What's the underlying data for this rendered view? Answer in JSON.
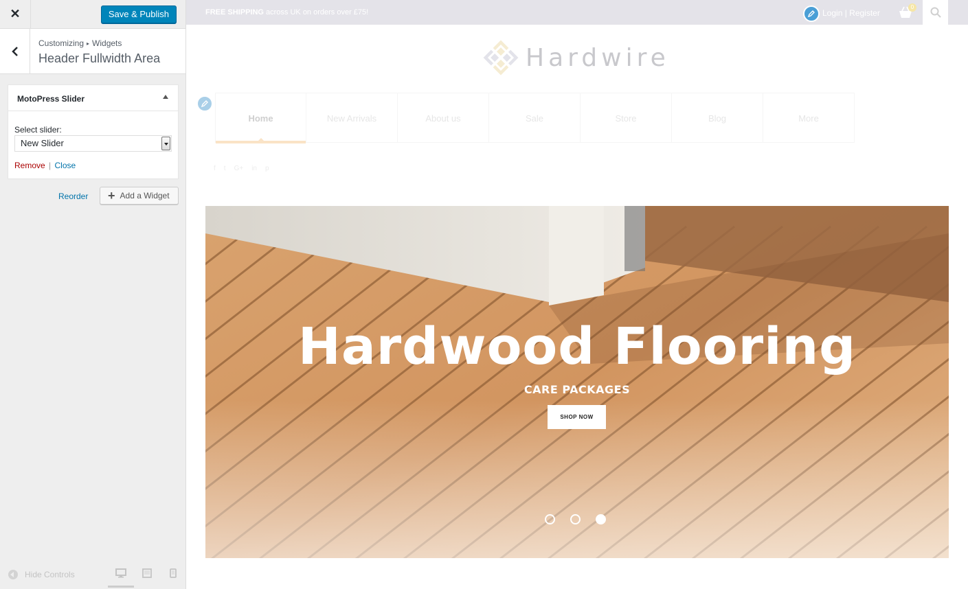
{
  "sidebar": {
    "close_label": "✕",
    "save_publish_label": "Save & Publish",
    "breadcrumb": {
      "root": "Customizing",
      "separator": "▸",
      "parent": "Widgets"
    },
    "section_title": "Header Fullwidth Area",
    "widget": {
      "title": "MotoPress Slider",
      "select_label": "Select slider:",
      "select_value": "New Slider",
      "remove_label": "Remove",
      "separator": "|",
      "close_label": "Close"
    },
    "reorder_label": "Reorder",
    "add_widget_label": "Add a Widget",
    "footer": {
      "hide_controls_label": "Hide Controls",
      "devices": [
        "desktop-icon",
        "tablet-icon",
        "mobile-icon"
      ],
      "active_device": "desktop"
    }
  },
  "preview": {
    "topbar": {
      "shipping_strong": "FREE SHIPPING",
      "shipping_rest": " across UK on orders over £75!",
      "account_label": "Login | Register",
      "cart_count": "0"
    },
    "logo_text": "Hardwire",
    "nav": [
      "Home",
      "New Arrivals",
      "About us",
      "Sale",
      "Store",
      "Blog",
      "More"
    ],
    "active_nav": "Home",
    "social_icons": [
      "f",
      "t",
      "G+",
      "in",
      "p"
    ],
    "slide": {
      "title": "Hardwood Flooring",
      "subtitle": "CARE PACKAGES",
      "button_label": "SHOP NOW",
      "dots": 3,
      "active_dot": 3
    }
  },
  "colors": {
    "primary_button": "#0085ba",
    "link": "#0073aa",
    "remove_link": "#aa0000",
    "topbar_bg": "#e4e3e9",
    "nav_active_underline": "#fae3c6"
  }
}
